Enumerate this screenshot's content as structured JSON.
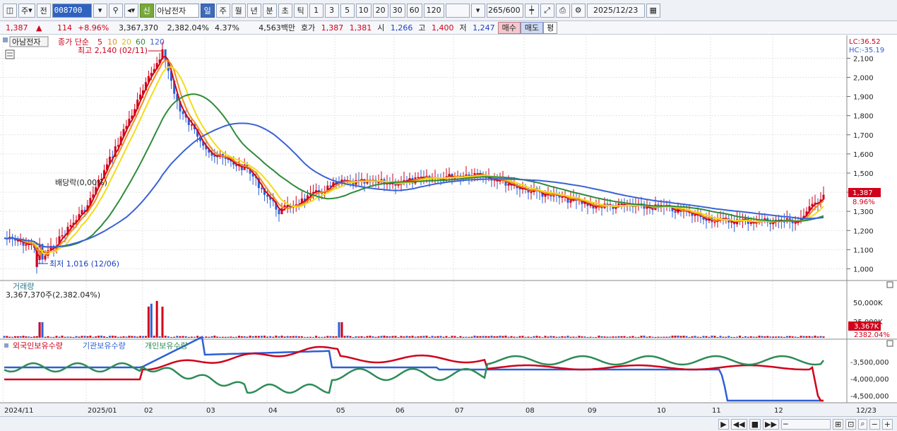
{
  "toolbar": {
    "market": "주",
    "prev_label": "전",
    "code": "008700",
    "credit_badge": "신",
    "stock_name": "아남전자",
    "periods": [
      "일",
      "주",
      "월",
      "년",
      "분",
      "초",
      "틱"
    ],
    "active_period": "일",
    "intervals": [
      "1",
      "3",
      "5",
      "10",
      "20",
      "30",
      "60",
      "120"
    ],
    "count": "265",
    "count_total": "/600",
    "date": "2025/12/23"
  },
  "infobar": {
    "price": "1,387",
    "change_arrow": "▲",
    "change": "114",
    "change_pct": "+8.96%",
    "volume": "3,367,370",
    "volume_pct": "2,382.04%",
    "turnover": "4.37%",
    "amount": "4,563백만",
    "ask_label": "호가",
    "ask": "1,387",
    "bid": "1,381",
    "open_label": "시",
    "open": "1,266",
    "high_label": "고",
    "high": "1,400",
    "low_label": "저",
    "low": "1,247",
    "buy_label": "매수",
    "sell_label": "매도",
    "avg_label": "평"
  },
  "price_panel": {
    "name_label": "아남전자",
    "ma_prefix": "종가 단순",
    "ma_periods": [
      "5",
      "10",
      "20",
      "60",
      "120"
    ],
    "ma_colors": [
      "#d0021b",
      "#f08c1c",
      "#f2dc1a",
      "#2e8b3a",
      "#3b62d6"
    ],
    "high_note": "최고 2,140 (02/11)",
    "low_note": "최저 1,016 (12/06)",
    "dividend_note": "배당락(0,00%)",
    "lc_label": "LC:36.52",
    "hc_label": "HC:-35.19",
    "y_ticks": [
      2100,
      2000,
      1900,
      1800,
      1700,
      1600,
      1500,
      1400,
      1300,
      1200,
      1100,
      1000
    ],
    "y_tick_labels": [
      "2,100",
      "2,000",
      "1,900",
      "1,800",
      "1,700",
      "1,600",
      "1,500",
      "1,400",
      "1,300",
      "1,200",
      "1,100",
      "1,000"
    ],
    "y_range": [
      950,
      2190
    ],
    "last_price": "1,387",
    "last_pct": "8.96%"
  },
  "volume_panel": {
    "title": "거래량",
    "value": "3,367,370주(2,382.04%)",
    "y_tick_labels": [
      "50,000K",
      "25,000K"
    ],
    "last_label": "3,367K",
    "last_pct": "2382.04%"
  },
  "holdings_panel": {
    "legend": [
      "외국인보유수량",
      "기관보유수량",
      "개인보유수량"
    ],
    "legend_colors": [
      "#d0021b",
      "#2d5fd6",
      "#2e8b57"
    ],
    "y_tick_labels": [
      "-3,500,000",
      "-4,000,000",
      "-4,500,000"
    ]
  },
  "x_axis": {
    "labels": [
      "2024/11",
      "2025/01",
      "02",
      "03",
      "04",
      "05",
      "06",
      "07",
      "08",
      "09",
      "10",
      "11",
      "12",
      "12/23"
    ]
  },
  "statusbar": {
    "controls": [
      "▶",
      "◀◀",
      "■",
      "▶▶",
      "─",
      "⊞",
      "⊡",
      "⌕",
      "−",
      "+"
    ]
  },
  "chart_data": {
    "type": "line",
    "x_period": "2024/11 – 2025/12/23 (daily)",
    "close_approx": [
      {
        "x": "2024-11",
        "y": 1160
      },
      {
        "x": "2024-12",
        "y": 1110
      },
      {
        "x": "2024-12-06",
        "y": 1016
      },
      {
        "x": "2025-01",
        "y": 1330
      },
      {
        "x": "2025-02-11",
        "y": 2140
      },
      {
        "x": "2025-02-20",
        "y": 1820
      },
      {
        "x": "2025-03",
        "y": 1600
      },
      {
        "x": "2025-03-20",
        "y": 1520
      },
      {
        "x": "2025-04",
        "y": 1300
      },
      {
        "x": "2025-05",
        "y": 1450
      },
      {
        "x": "2025-06",
        "y": 1450
      },
      {
        "x": "2025-07",
        "y": 1500
      },
      {
        "x": "2025-08",
        "y": 1420
      },
      {
        "x": "2025-09",
        "y": 1330
      },
      {
        "x": "2025-10",
        "y": 1320
      },
      {
        "x": "2025-11",
        "y": 1250
      },
      {
        "x": "2025-12",
        "y": 1250
      },
      {
        "x": "2025-12-23",
        "y": 1387
      }
    ],
    "ylim": [
      1000,
      2100
    ]
  }
}
